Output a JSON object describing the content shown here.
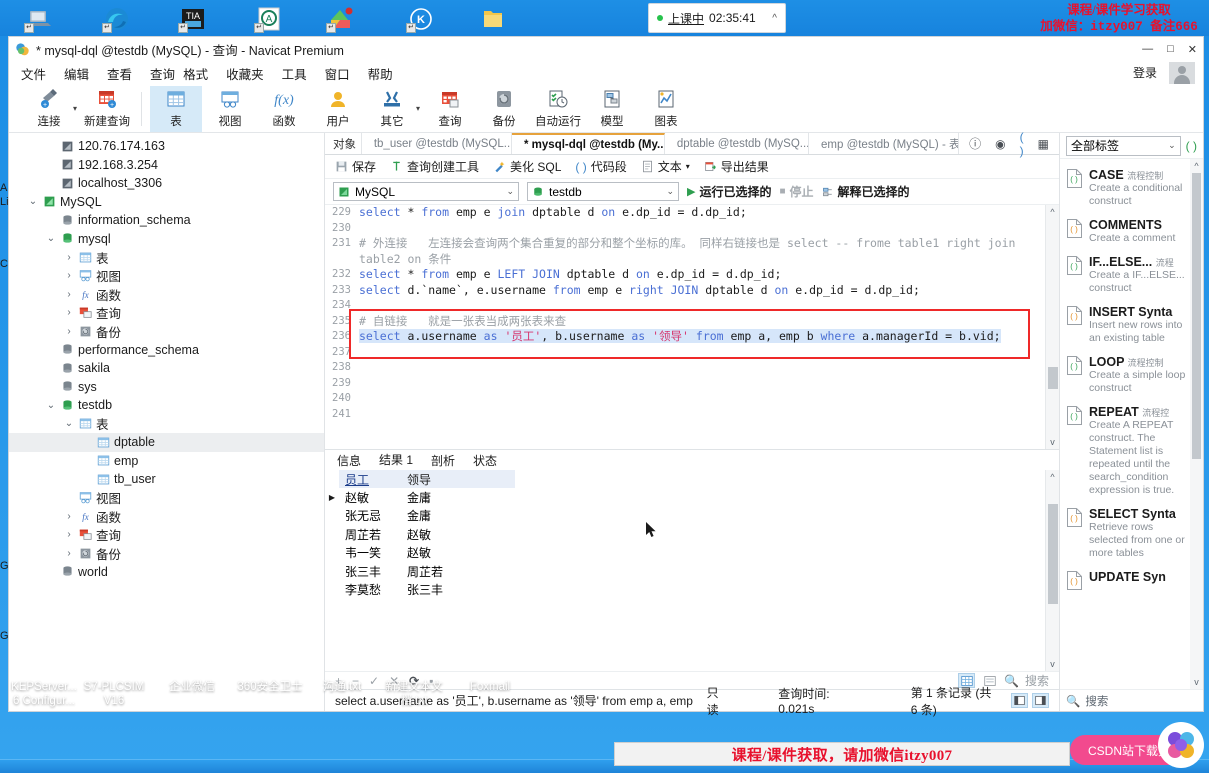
{
  "taskbar": {
    "apps": [
      "remote-desktop-icon",
      "edge-icon",
      "tia-portal-icon",
      "app-a-icon",
      "app-colors-icon",
      "kepware-k-icon",
      "folder-icon"
    ],
    "clock": {
      "status": "上课中",
      "time": "02:35:41",
      "chevron": "^"
    },
    "promo_top_line1": "课程/课件学习获取",
    "promo_top_line2": "加微信：itzy007 备注666",
    "desktop_icons": [
      {
        "l1": "KEPServer...",
        "l2": "6 Configur..."
      },
      {
        "l1": "S7-PLCSIM",
        "l2": "V16"
      },
      {
        "l1": "企业微信",
        "l2": ""
      },
      {
        "l1": "360安全卫士",
        "l2": ""
      },
      {
        "l1": "沟通.txt",
        "l2": ""
      },
      {
        "l1": "新建文本文",
        "l2": "档.txt"
      },
      {
        "l1": "Foxmail",
        "l2": ""
      }
    ],
    "promo_bottom": "课程/课件获取，请加微信itzy007",
    "pink_pill": "CSDN站下载资源"
  },
  "window": {
    "title": "* mysql-dql @testdb (MySQL) - 查询 - Navicat Premium",
    "minimize": "—",
    "maximize": "□",
    "close": "✕",
    "login": "登录"
  },
  "menu": {
    "items": [
      "文件",
      "编辑",
      "查看",
      "查询",
      "格式",
      "收藏夹",
      "工具",
      "窗口",
      "帮助"
    ]
  },
  "toolbar": {
    "buttons": [
      {
        "label": "连接",
        "icon": "connection-icon",
        "caret": true,
        "active": false
      },
      {
        "label": "新建查询",
        "icon": "new-query-icon",
        "caret": false,
        "active": false
      },
      {
        "label": "表",
        "icon": "table-icon",
        "caret": false,
        "active": true
      },
      {
        "label": "视图",
        "icon": "view-icon",
        "caret": false,
        "active": false
      },
      {
        "label": "函数",
        "icon": "function-icon",
        "caret": false,
        "active": false
      },
      {
        "label": "用户",
        "icon": "user-icon",
        "caret": false,
        "active": false
      },
      {
        "label": "其它",
        "icon": "other-tools-icon",
        "caret": true,
        "active": false
      },
      {
        "label": "查询",
        "icon": "query-icon",
        "caret": false,
        "active": false
      },
      {
        "label": "备份",
        "icon": "backup-icon",
        "caret": false,
        "active": false
      },
      {
        "label": "自动运行",
        "icon": "automation-icon",
        "caret": false,
        "active": false
      },
      {
        "label": "模型",
        "icon": "model-icon",
        "caret": false,
        "active": false
      },
      {
        "label": "图表",
        "icon": "chart-icon",
        "caret": false,
        "active": false
      }
    ]
  },
  "sidebar": {
    "items": [
      {
        "indent": 1,
        "twisty": "",
        "icon": "connection-icon",
        "label": "120.76.174.163",
        "sel": false
      },
      {
        "indent": 1,
        "twisty": "",
        "icon": "connection-icon",
        "label": "192.168.3.254",
        "sel": false
      },
      {
        "indent": 1,
        "twisty": "",
        "icon": "connection-icon",
        "label": "localhost_3306",
        "sel": false
      },
      {
        "indent": 0,
        "twisty": "v",
        "icon": "connection-green-icon",
        "label": "MySQL",
        "sel": false
      },
      {
        "indent": 1,
        "twisty": "",
        "icon": "database-gray-icon",
        "label": "information_schema",
        "sel": false
      },
      {
        "indent": 1,
        "twisty": "v",
        "icon": "database-green-icon",
        "label": "mysql",
        "sel": false
      },
      {
        "indent": 2,
        "twisty": ">",
        "icon": "table-icon",
        "label": "表",
        "sel": false
      },
      {
        "indent": 2,
        "twisty": ">",
        "icon": "view-icon",
        "label": "视图",
        "sel": false
      },
      {
        "indent": 2,
        "twisty": ">",
        "icon": "function-icon",
        "label": "函数",
        "sel": false
      },
      {
        "indent": 2,
        "twisty": ">",
        "icon": "query-icon",
        "label": "查询",
        "sel": false
      },
      {
        "indent": 2,
        "twisty": ">",
        "icon": "backup-icon",
        "label": "备份",
        "sel": false
      },
      {
        "indent": 1,
        "twisty": "",
        "icon": "database-gray-icon",
        "label": "performance_schema",
        "sel": false
      },
      {
        "indent": 1,
        "twisty": "",
        "icon": "database-gray-icon",
        "label": "sakila",
        "sel": false
      },
      {
        "indent": 1,
        "twisty": "",
        "icon": "database-gray-icon",
        "label": "sys",
        "sel": false
      },
      {
        "indent": 1,
        "twisty": "v",
        "icon": "database-green-icon",
        "label": "testdb",
        "sel": false
      },
      {
        "indent": 2,
        "twisty": "v",
        "icon": "table-icon",
        "label": "表",
        "sel": false
      },
      {
        "indent": 3,
        "twisty": "",
        "icon": "table-icon",
        "label": "dptable",
        "sel": true
      },
      {
        "indent": 3,
        "twisty": "",
        "icon": "table-icon",
        "label": "emp",
        "sel": false
      },
      {
        "indent": 3,
        "twisty": "",
        "icon": "table-icon",
        "label": "tb_user",
        "sel": false
      },
      {
        "indent": 2,
        "twisty": "",
        "icon": "view-icon",
        "label": "视图",
        "sel": false
      },
      {
        "indent": 2,
        "twisty": ">",
        "icon": "function-icon",
        "label": "函数",
        "sel": false
      },
      {
        "indent": 2,
        "twisty": ">",
        "icon": "query-icon",
        "label": "查询",
        "sel": false
      },
      {
        "indent": 2,
        "twisty": ">",
        "icon": "backup-icon",
        "label": "备份",
        "sel": false
      },
      {
        "indent": 1,
        "twisty": "",
        "icon": "database-gray-icon",
        "label": "world",
        "sel": false
      }
    ]
  },
  "doctabs": {
    "object_label": "对象",
    "tabs": [
      {
        "label": "tb_user @testdb (MySQL...",
        "icon": "table-icon",
        "active": false
      },
      {
        "label": "* mysql-dql @testdb (My...",
        "icon": "query-icon",
        "active": true
      },
      {
        "label": "dptable @testdb (MySQ...",
        "icon": "table-icon",
        "active": false
      },
      {
        "label": "emp @testdb (MySQL) - 表",
        "icon": "table-icon",
        "active": false
      }
    ],
    "right_icons": [
      "info-icon",
      "eye-icon",
      "code-icon",
      "grid-icon"
    ]
  },
  "query_toolbar": {
    "items": [
      {
        "label": "保存",
        "icon": "save-icon"
      },
      {
        "label": "查询创建工具",
        "icon": "query-builder-icon"
      },
      {
        "label": "美化 SQL",
        "icon": "beautify-icon"
      },
      {
        "label": "代码段",
        "icon": "snippet-icon"
      },
      {
        "label": "文本",
        "icon": "text-icon",
        "caret": true
      },
      {
        "label": "导出结果",
        "icon": "export-icon"
      }
    ]
  },
  "conn_row": {
    "connection": "MySQL",
    "database": "testdb",
    "run_label": "运行已选择的",
    "stop_label": "停止",
    "explain_label": "解释已选择的"
  },
  "editor": {
    "lines": [
      {
        "n": "229",
        "html": "<span class='kw'>select</span> * <span class='kw'>from</span> emp e <span class='kw'>join</span> dptable d <span class='kw'>on</span> e.dp_id = d.dp_id;"
      },
      {
        "n": "230",
        "html": ""
      },
      {
        "n": "231",
        "html": "<span class='cm'># 外连接   左连接会查询两个集合重复的部分和整个坐标的库。 同样右链接也是 select -- frome table1 right join table2 on 条件</span>"
      },
      {
        "n": "232",
        "html": "<span class='kw'>select</span> * <span class='kw'>from</span> emp e <span class='kw'>LEFT JOIN</span> dptable d <span class='kw'>on</span> e.dp_id = d.dp_id;"
      },
      {
        "n": "233",
        "html": "<span class='kw'>select</span> d.`name`, e.username <span class='kw'>from</span> emp e <span class='kw'>right JOIN</span> dptable d <span class='kw'>on</span> e.dp_id = d.dp_id;"
      },
      {
        "n": "234",
        "html": ""
      },
      {
        "n": "235",
        "html": "<span class='cm'># 自链接   就是一张表当成两张表来查</span>"
      },
      {
        "n": "236",
        "html": "<span class='sel-bg'><span class='kw'>select</span> a.username <span class='kw'>as</span> <span class='str'>'员工'</span>, b.username <span class='kw'>as</span> <span class='str'>'领导'</span> <span class='kw'>from</span> emp a, emp b <span class='kw'>where</span> a.managerId = b.vid;</span>"
      },
      {
        "n": "237",
        "html": ""
      },
      {
        "n": "238",
        "html": ""
      },
      {
        "n": "239",
        "html": ""
      },
      {
        "n": "240",
        "html": ""
      },
      {
        "n": "241",
        "html": ""
      }
    ],
    "scroll_up": "^",
    "scroll_down": "v"
  },
  "results": {
    "tabs": [
      {
        "label": "信息",
        "active": false
      },
      {
        "label": "结果 1",
        "active": true
      },
      {
        "label": "剖析",
        "active": false
      },
      {
        "label": "状态",
        "active": false
      }
    ],
    "columns": [
      "员工",
      "领导"
    ],
    "rows": [
      {
        "员工": "赵敏",
        "领导": "金庸"
      },
      {
        "员工": "张无忌",
        "领导": "金庸"
      },
      {
        "员工": "周芷若",
        "领导": "赵敏"
      },
      {
        "员工": "韦一笑",
        "领导": "赵敏"
      },
      {
        "员工": "张三丰",
        "领导": "周芷若"
      },
      {
        "员工": "李莫愁",
        "领导": "张三丰"
      }
    ],
    "current_row_index": 0,
    "footer_buttons": [
      "add-icon",
      "remove-icon",
      "confirm-icon",
      "cancel-icon",
      "refresh-icon",
      "stop-icon"
    ],
    "view_grid": "grid-view-icon",
    "view_form": "form-view-icon",
    "search_label": "搜索"
  },
  "statusbar": {
    "sql": "select a.username as '员工', b.username as '领导' from emp a, emp b where a.man",
    "readonly": "只读",
    "query_time": "查询时间: 0.021s",
    "record_info": "第 1 条记录 (共 6 条)",
    "pane_buttons": [
      "left-pane-icon",
      "right-pane-icon"
    ]
  },
  "snippets": {
    "filter_value": "全部标签",
    "add_icon": "add-snippet-icon",
    "search_label": "搜索",
    "items": [
      {
        "title": "CASE",
        "tag": "流程控制",
        "desc": "Create a conditional construct",
        "color": "#2e9e4f"
      },
      {
        "title": "COMMENTS",
        "tag": "",
        "desc": "Create a comment",
        "color": "#e08a1e"
      },
      {
        "title": "IF...ELSE...",
        "tag": "流程",
        "desc": "Create a IF...ELSE... construct",
        "color": "#2e9e4f"
      },
      {
        "title": "INSERT Synta",
        "tag": "",
        "desc": "Insert new rows into an existing table",
        "color": "#e08a1e"
      },
      {
        "title": "LOOP",
        "tag": "流程控制",
        "desc": "Create a simple loop construct",
        "color": "#2e9e4f"
      },
      {
        "title": "REPEAT",
        "tag": "流程控",
        "desc": "Create A REPEAT construct. The Statement list is repeated until the search_condition expression is true.",
        "color": "#2e9e4f"
      },
      {
        "title": "SELECT Synta",
        "tag": "",
        "desc": "Retrieve rows selected from one or more tables",
        "color": "#e08a1e"
      },
      {
        "title": "UPDATE Syn",
        "tag": "",
        "desc": "",
        "color": "#e08a1e"
      }
    ]
  }
}
